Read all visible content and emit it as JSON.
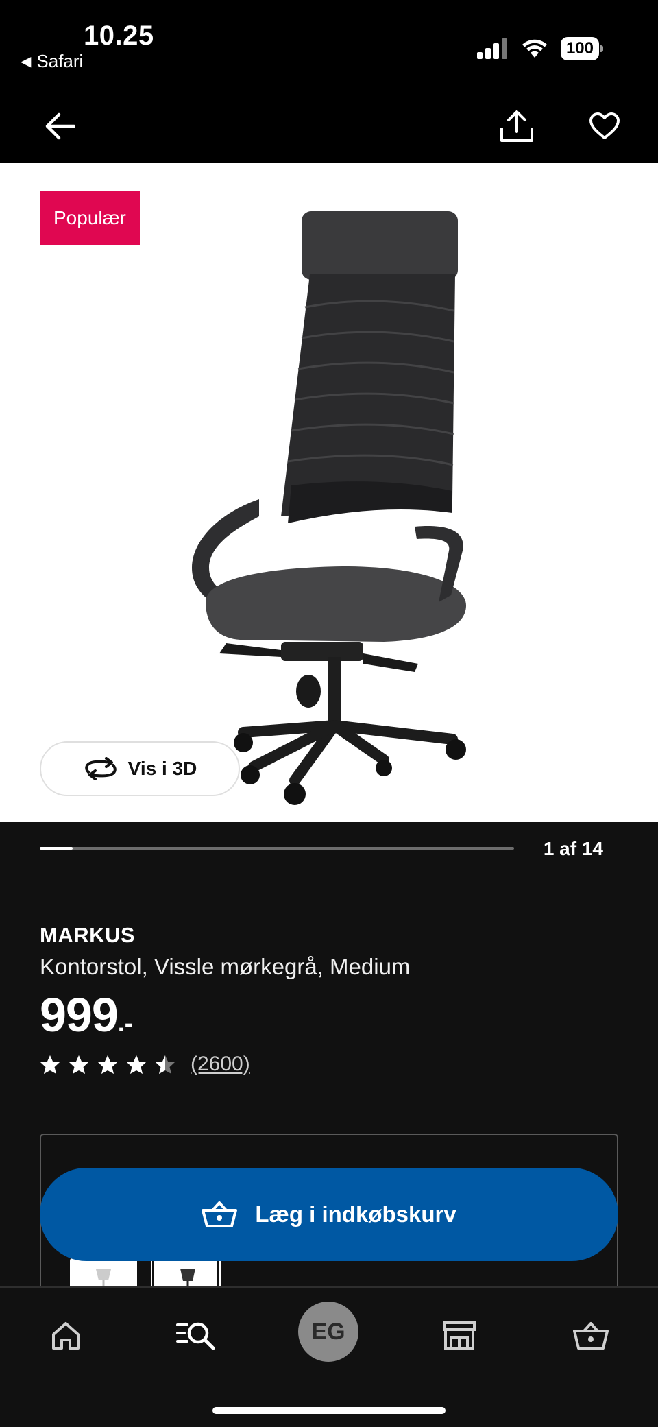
{
  "status_bar": {
    "time": "10.25",
    "back_app": "Safari",
    "battery": "100"
  },
  "product": {
    "badge": "Populær",
    "view_3d_label": "Vis i 3D",
    "gallery_position": "1 af 14",
    "gallery_progress": 0.07,
    "name": "MARKUS",
    "description": "Kontorstol, Vissle mørkegrå, Medium",
    "price": "999",
    "price_suffix": ".-",
    "rating": 4.5,
    "rating_count": "(2600)"
  },
  "actions": {
    "add_to_cart": "Læg i indkøbskurv"
  },
  "tab_bar": {
    "avatar_initials": "EG"
  },
  "colors": {
    "badge": "#e00751",
    "primary_button": "#0058a3",
    "background": "#111111"
  }
}
